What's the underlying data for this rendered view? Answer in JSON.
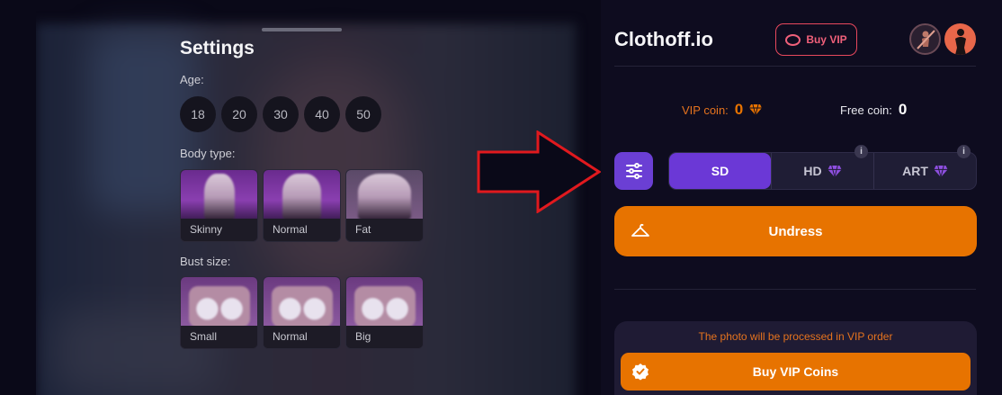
{
  "settings": {
    "title": "Settings",
    "age_label": "Age:",
    "ages": [
      "18",
      "20",
      "30",
      "40",
      "50"
    ],
    "body_label": "Body type:",
    "body_types": [
      "Skinny",
      "Normal",
      "Fat"
    ],
    "bust_label": "Bust size:",
    "bust_sizes": [
      "Small",
      "Normal",
      "Big"
    ]
  },
  "header": {
    "brand": "Clothoff.io",
    "buy_vip": "Buy VIP"
  },
  "coins": {
    "vip_label": "VIP coin:",
    "vip_value": "0",
    "free_label": "Free coin:",
    "free_value": "0"
  },
  "quality": {
    "options": [
      "SD",
      "HD",
      "ART"
    ],
    "selected": "SD",
    "info_glyph": "i"
  },
  "actions": {
    "undress": "Undress",
    "vip_notice": "The photo will be processed in VIP order",
    "buy_vip_coins": "Buy VIP Coins"
  },
  "colors": {
    "accent_orange": "#e77300",
    "accent_purple": "#6b38d6",
    "vip_red": "#e8485d",
    "arrow_red": "#e0191e"
  },
  "icons": [
    "gem-icon",
    "filter-sliders-icon",
    "hanger-icon",
    "verified-badge-icon",
    "vip-ring-icon",
    "info-icon"
  ]
}
